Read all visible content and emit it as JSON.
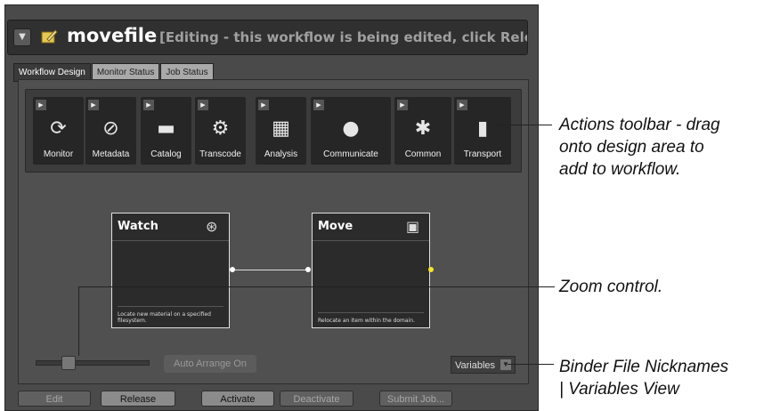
{
  "window": {
    "name": "movefile",
    "status": "[Editing - this workflow is being edited, click Release wh"
  },
  "tabs": [
    {
      "label": "Workflow Design",
      "active": true
    },
    {
      "label": "Monitor Status",
      "active": false
    },
    {
      "label": "Job Status",
      "active": false
    }
  ],
  "actions_toolbar": [
    {
      "label": "Monitor",
      "icon": "refresh-icon"
    },
    {
      "label": "Metadata",
      "icon": "paperclip-icon"
    },
    {
      "label": "Catalog",
      "icon": "folder-icon"
    },
    {
      "label": "Transcode",
      "icon": "gear-icon"
    },
    {
      "label": "Analysis",
      "icon": "ruler-icon"
    },
    {
      "label": "Communicate",
      "icon": "speech-bubble-icon"
    },
    {
      "label": "Common",
      "icon": "puzzle-icon"
    },
    {
      "label": "Transport",
      "icon": "document-icon"
    }
  ],
  "nodes": {
    "watch": {
      "title": "Watch",
      "description": "Locate new material on a specified filesystem."
    },
    "move": {
      "title": "Move",
      "description": "Relocate an item within the domain."
    }
  },
  "controls": {
    "auto_arrange": "Auto Arrange On",
    "variables": "Variables"
  },
  "bottom_buttons": {
    "edit": "Edit",
    "release": "Release",
    "activate": "Activate",
    "deactivate": "Deactivate",
    "submit_job": "Submit Job..."
  },
  "annotations": {
    "toolbar": [
      "Actions toolbar - drag",
      "onto design area to",
      "add to workflow."
    ],
    "zoom": [
      "Zoom control."
    ],
    "binder": [
      "Binder File Nicknames",
      "| Variables View"
    ]
  },
  "colors": {
    "connector_port": "#f5e42b",
    "panel": "#4a4a4a"
  }
}
